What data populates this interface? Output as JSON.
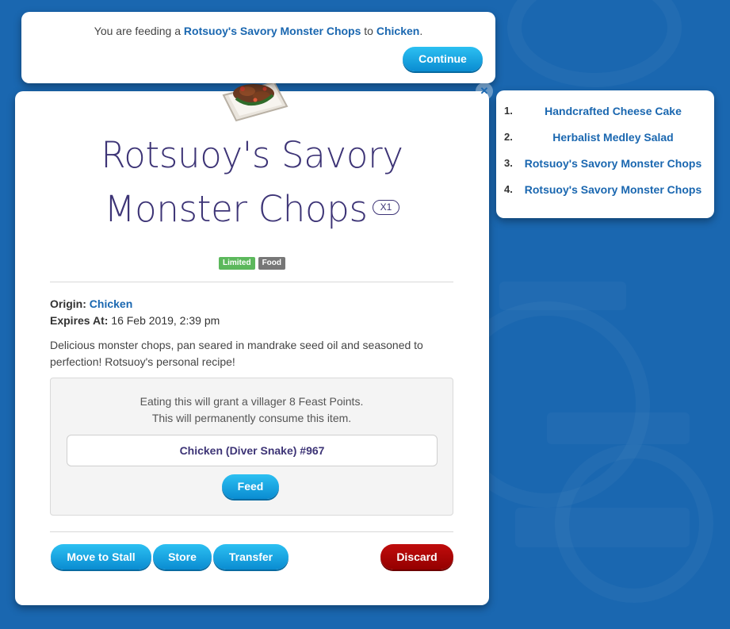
{
  "dialog": {
    "prefix": "You are feeding a ",
    "item_name": "Rotsuoy's Savory Monster Chops",
    "middle": " to ",
    "target": "Chicken",
    "suffix": ".",
    "continue_label": "Continue",
    "close_icon": "close-icon"
  },
  "item": {
    "title_line1": "Rotsuoy's Savory",
    "title_line2": "Monster Chops",
    "quantity": "X1",
    "tags": [
      "Limited",
      "Food"
    ],
    "origin_label": "Origin:",
    "origin_value": "Chicken",
    "expires_label": "Expires At:",
    "expires_value": "16 Feb 2019, 2:39 pm",
    "description": "Delicious monster chops, pan seared in mandrake seed oil and seasoned to perfection! Rotsuoy's personal recipe!"
  },
  "feed": {
    "info_line1": "Eating this will grant a villager 8 Feast Points.",
    "info_line2": "This will permanently consume this item.",
    "selected_villager": "Chicken (Diver Snake) #967",
    "feed_label": "Feed"
  },
  "actions": {
    "move_to_stall": "Move to Stall",
    "store": "Store",
    "transfer": "Transfer",
    "discard": "Discard"
  },
  "side_list": [
    {
      "num": "1.",
      "label": "Handcrafted Cheese Cake"
    },
    {
      "num": "2.",
      "label": "Herbalist Medley Salad"
    },
    {
      "num": "3.",
      "label": "Rotsuoy's Savory Monster Chops"
    },
    {
      "num": "4.",
      "label": "Rotsuoy's Savory Monster Chops"
    }
  ],
  "colors": {
    "background": "#1a67b0",
    "title": "#3d3476",
    "link": "#1a67b0",
    "button": "#1aa4e3",
    "discard": "#b00606",
    "tag_limited": "#5cb85c",
    "tag_food": "#777777"
  }
}
